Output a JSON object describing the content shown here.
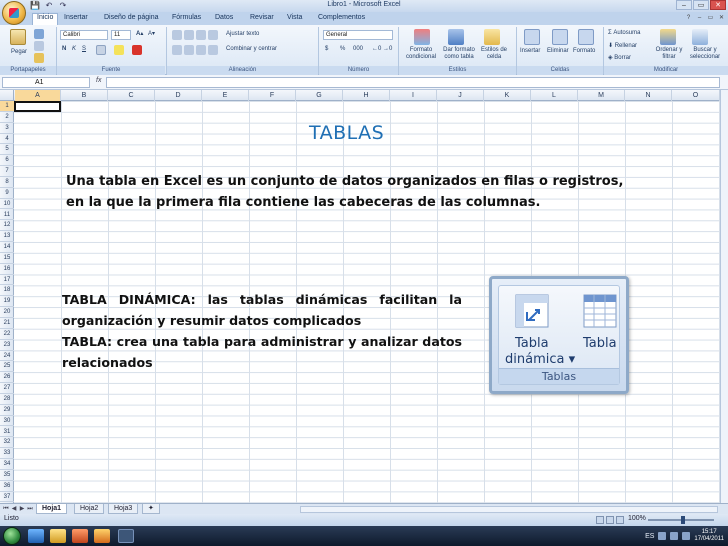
{
  "window": {
    "title": "Libro1 - Microsoft Excel",
    "controls": [
      "–",
      "▭",
      "✕"
    ]
  },
  "qat": {
    "save": "💾",
    "undo": "↶",
    "redo": "↷"
  },
  "ribbon": {
    "tabs": [
      "Inicio",
      "Insertar",
      "Diseño de página",
      "Fórmulas",
      "Datos",
      "Revisar",
      "Vista",
      "Complementos"
    ],
    "active_tab": "Inicio",
    "clipboard": {
      "paste_label": "Pegar",
      "group_label": "Portapapeles"
    },
    "font": {
      "name": "Calibri",
      "size": "11",
      "group_label": "Fuente",
      "bold": "N",
      "italic": "K",
      "underline": "S"
    },
    "alignment": {
      "wrap_label": "Ajustar texto",
      "merge_label": "Combinar y centrar",
      "group_label": "Alineación"
    },
    "number": {
      "format": "General",
      "currency": "$",
      "percent": "%",
      "thousands": "000",
      "group_label": "Número"
    },
    "styles": {
      "cond_format_label": "Formato condicional",
      "format_table_label": "Dar formato como tabla",
      "cell_styles_label": "Estilos de celda",
      "group_label": "Estilos"
    },
    "cells": {
      "insert_label": "Insertar",
      "delete_label": "Eliminar",
      "format_label": "Formato",
      "group_label": "Celdas"
    },
    "editing": {
      "autosum_label": "Autosuma",
      "fill_label": "Rellenar",
      "clear_label": "Borrar",
      "sort_label": "Ordenar y filtrar",
      "find_label": "Buscar y seleccionar",
      "group_label": "Modificar"
    }
  },
  "formula_bar": {
    "name_box": "A1",
    "fx": "fx",
    "formula": ""
  },
  "grid": {
    "columns": [
      "A",
      "B",
      "C",
      "D",
      "E",
      "F",
      "G",
      "H",
      "I",
      "J",
      "K",
      "L",
      "M",
      "N",
      "O"
    ],
    "rows": [
      "1",
      "2",
      "3",
      "4",
      "5",
      "6",
      "7",
      "8",
      "9",
      "10",
      "11",
      "12",
      "13",
      "14",
      "15",
      "16",
      "17",
      "18",
      "19",
      "20",
      "21",
      "22",
      "23",
      "24",
      "25",
      "26",
      "27",
      "28",
      "29",
      "30",
      "31",
      "32",
      "33",
      "34",
      "35",
      "36",
      "37"
    ]
  },
  "content": {
    "title": "TABLAS",
    "paragraph_line1": "Una tabla en Excel es un conjunto de datos organizados en filas o registros,",
    "paragraph_line2": "en la que la primera fila contiene las cabeceras de las columnas.",
    "def_dynamic": "TABLA DINÁMICA: las tablas dinámicas facilitan la organización y resumir datos complicados",
    "def_table": "TABLA: crea una tabla para administrar y analizar datos relacionados"
  },
  "inset": {
    "pivot_label_line1": "Tabla",
    "pivot_label_line2": "dinámica ▾",
    "table_label": "Tabla",
    "group_label": "Tablas"
  },
  "sheet_tabs": [
    "Hoja1",
    "Hoja2",
    "Hoja3"
  ],
  "active_sheet": "Hoja1",
  "status": {
    "text": "Listo",
    "zoom": "100%"
  },
  "taskbar": {
    "language": "ES",
    "time": "15:17",
    "date": "17/04/2011"
  },
  "colors": {
    "title_blue": "#1f6fb4",
    "ribbon": "#dbe7f5",
    "selected_header": "#f9d99b"
  }
}
